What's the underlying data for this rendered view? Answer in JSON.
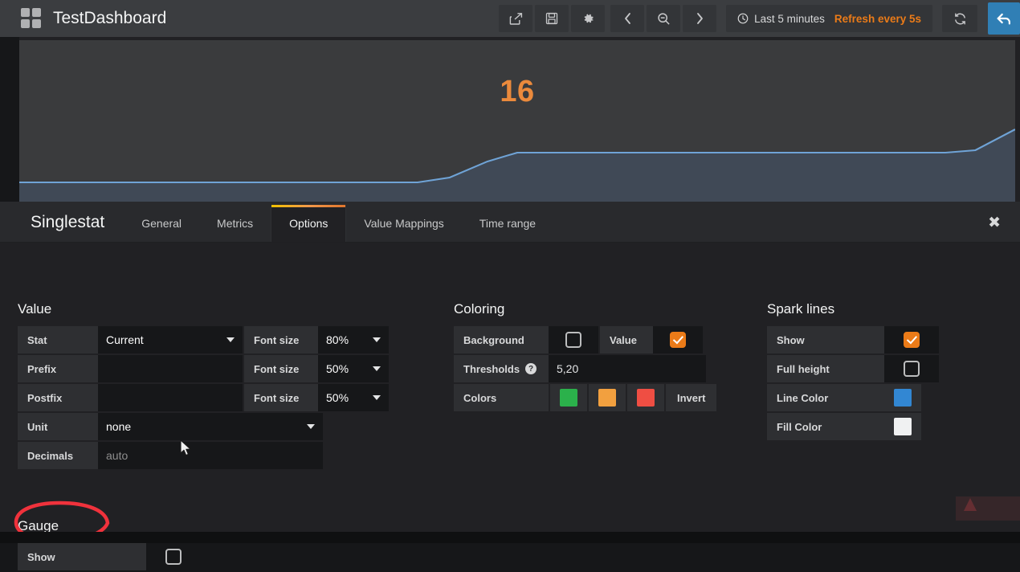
{
  "navbar": {
    "dashboard_title": "TestDashboard",
    "grid_icon": "grid-icon",
    "buttons": [
      {
        "name": "share-dashboard-button",
        "icon": "share-icon"
      },
      {
        "name": "save-dashboard-button",
        "icon": "save-icon"
      },
      {
        "name": "dashboard-settings-button",
        "icon": "gear-icon"
      },
      {
        "name": "time-shift-back-button",
        "icon": "chevron-left-icon"
      },
      {
        "name": "zoom-out-button",
        "icon": "search-minus-icon"
      },
      {
        "name": "time-shift-forward-button",
        "icon": "chevron-right-icon"
      }
    ],
    "timepicker": {
      "clock_icon": "clock-icon",
      "range": "Last 5 minutes",
      "refresh": "Refresh every 5s"
    },
    "refresh_button": {
      "name": "refresh-button",
      "icon": "refresh-icon"
    },
    "back_button": {
      "name": "back-button",
      "icon": "back-arrow-icon"
    }
  },
  "panel": {
    "value": "16",
    "value_color": "#eb8a3c",
    "sparkline_line_color": "#5b9bd5",
    "sparkline_fill_color": "#46556b"
  },
  "editor": {
    "panel_type": "Singlestat",
    "tabs": [
      {
        "label": "General",
        "active": false
      },
      {
        "label": "Metrics",
        "active": false
      },
      {
        "label": "Options",
        "active": true
      },
      {
        "label": "Value Mappings",
        "active": false
      },
      {
        "label": "Time range",
        "active": false
      }
    ],
    "close_label": "✖"
  },
  "value_section": {
    "title": "Value",
    "stat_label": "Stat",
    "stat_value": "Current",
    "prefix_label": "Prefix",
    "prefix_value": "",
    "postfix_label": "Postfix",
    "postfix_value": "",
    "font_size_label": "Font size",
    "stat_font_size": "80%",
    "prefix_font_size": "50%",
    "postfix_font_size": "50%",
    "unit_label": "Unit",
    "unit_value": "none",
    "decimals_label": "Decimals",
    "decimals_value": "",
    "decimals_placeholder": "auto"
  },
  "coloring_section": {
    "title": "Coloring",
    "background_label": "Background",
    "background_checked": false,
    "value_label": "Value",
    "value_checked": true,
    "thresholds_label": "Thresholds",
    "thresholds_help": "?",
    "thresholds_value": "5,20",
    "colors_label": "Colors",
    "color_1": "#2bb14b",
    "color_2": "#f2a03f",
    "color_3": "#ef4e43",
    "invert_label": "Invert"
  },
  "sparklines_section": {
    "title": "Spark lines",
    "show_label": "Show",
    "show_checked": true,
    "full_height_label": "Full height",
    "full_height_checked": false,
    "line_color_label": "Line Color",
    "line_color": "#3287d3",
    "fill_color_label": "Fill Color",
    "fill_color": "#f0f1f2"
  },
  "gauge_section": {
    "title": "Gauge",
    "show_label": "Show",
    "show_checked": false,
    "annotation_color": "#f0323c"
  }
}
